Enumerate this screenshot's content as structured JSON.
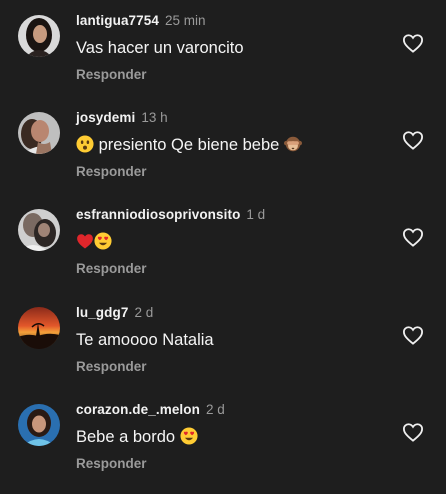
{
  "comments": [
    {
      "username": "lantigua7754",
      "time": "25 min",
      "text": "Vas hacer un varoncito",
      "reply_label": "Responder",
      "avatar": "avatar-dark-hair-woman",
      "emojis": []
    },
    {
      "username": "josydemi",
      "time": "13 h",
      "text": "presiento Qe biene bebe",
      "reply_label": "Responder",
      "avatar": "avatar-woman-portrait",
      "emojis": [
        "hushed-face-emoji",
        "see-no-evil-monkey-emoji"
      ]
    },
    {
      "username": "esfranniodiosoprivonsito",
      "time": "1 d",
      "text": "",
      "reply_label": "Responder",
      "avatar": "avatar-hug-photo",
      "emojis": [
        "red-heart-emoji",
        "heart-eyes-emoji"
      ]
    },
    {
      "username": "lu_gdg7",
      "time": "2 d",
      "text": "Te amoooo Natalia",
      "reply_label": "Responder",
      "avatar": "avatar-sunset",
      "emojis": []
    },
    {
      "username": "corazon.de_.melon",
      "time": "2 d",
      "text": "Bebe a bordo",
      "reply_label": "Responder",
      "avatar": "avatar-woman-blue",
      "emojis": [
        "heart-eyes-emoji"
      ]
    }
  ],
  "colors": {
    "background": "#1e1e1e",
    "text": "#f5f5f5",
    "secondary": "#9a9a9a",
    "heart_outline": "#f0f0f0"
  }
}
